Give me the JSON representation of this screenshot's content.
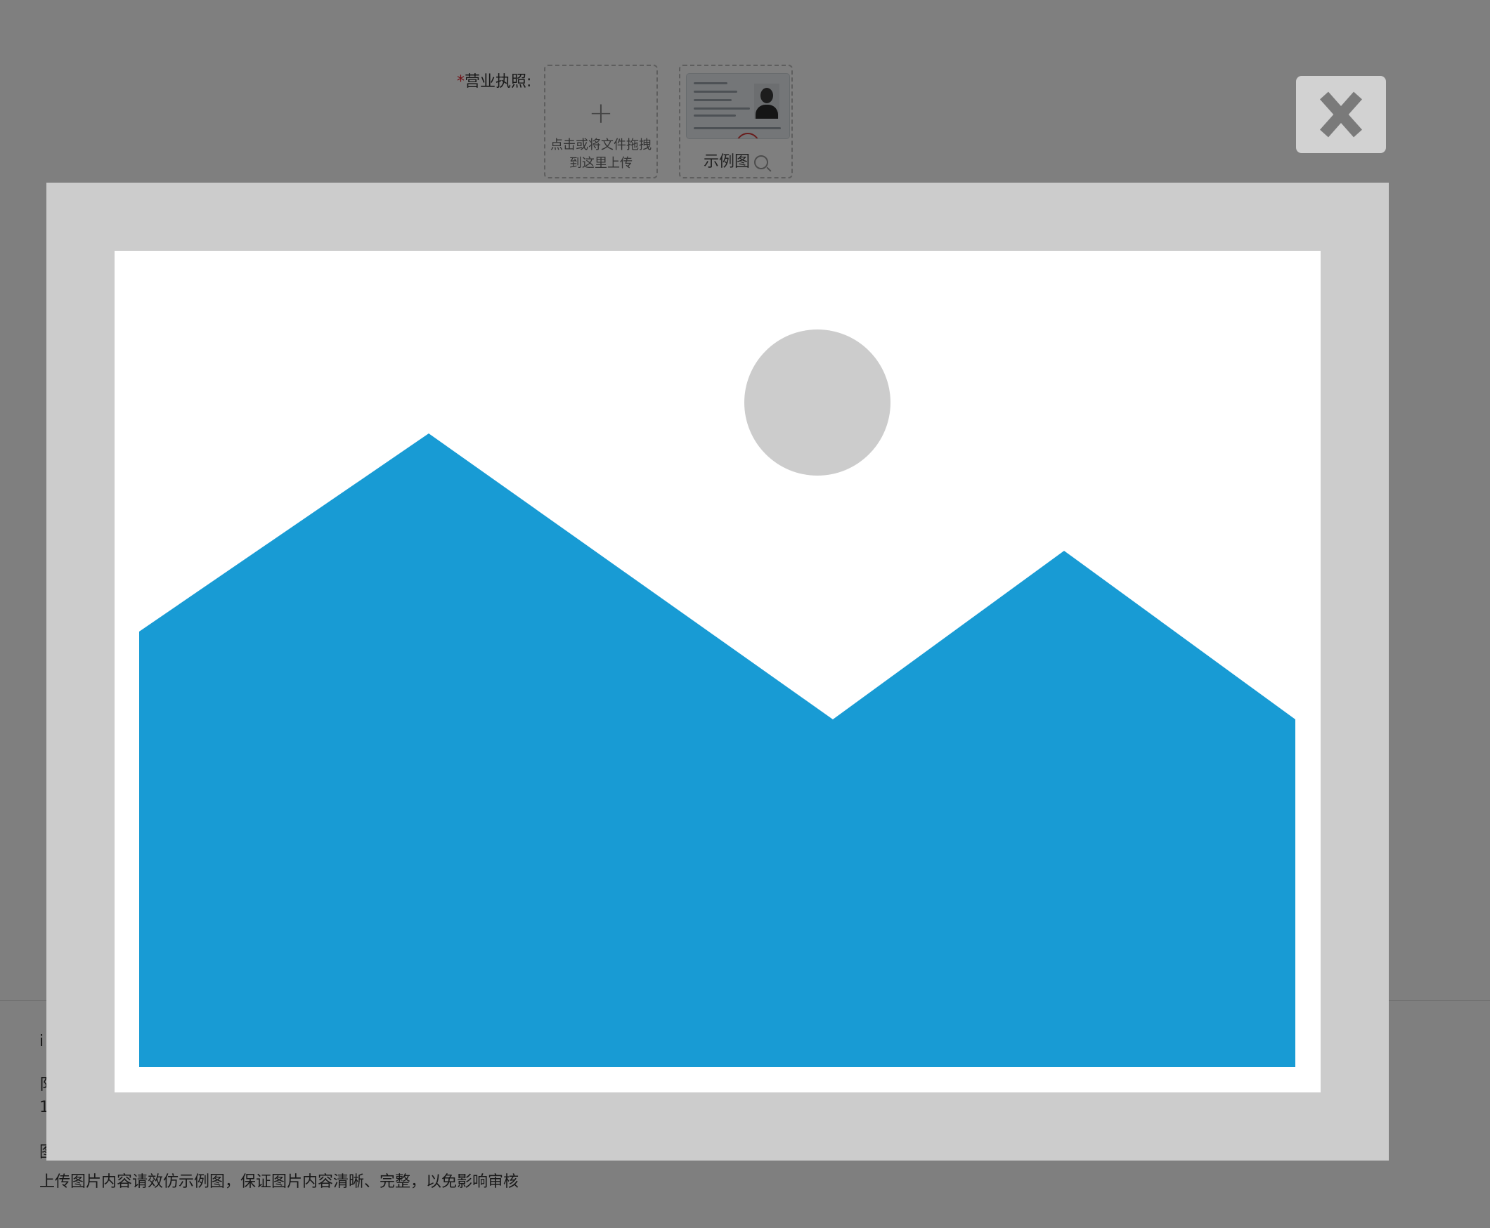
{
  "form": {
    "business_license": {
      "required_mark": "*",
      "label": "营业执照:",
      "upload_hint": "点击或将文件拖拽到这里上传",
      "sample_label": "示例图"
    }
  },
  "bottom_info": {
    "partial_lines": [
      "i",
      "阝",
      "1",
      "图"
    ],
    "note": "上传图片内容请效仿示例图，保证图片内容清晰、完整，以免影响审核"
  },
  "lightbox": {
    "image": "image-placeholder-icon",
    "close_icon": "close-icon",
    "colors": {
      "backdrop": "#000000",
      "frame": "#cccccc",
      "mountain": "#189bd4",
      "sun": "#cccccc",
      "close_button_bg": "#d2d2d2",
      "close_glyph": "#7a7a7a"
    }
  }
}
